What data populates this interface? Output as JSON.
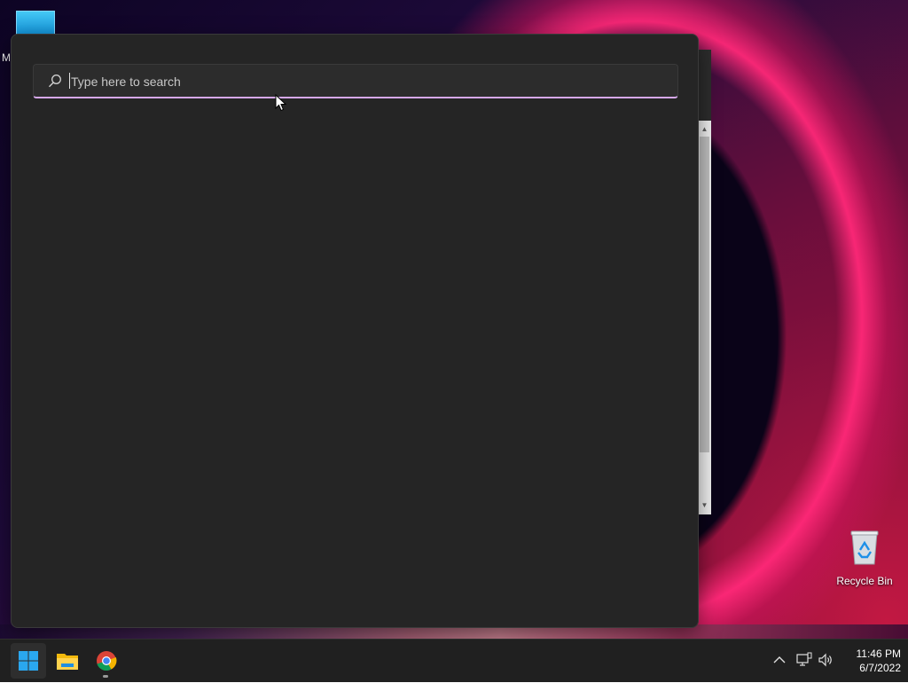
{
  "desktop": {
    "top_icon_label": "M",
    "recycle_bin_label": "Recycle Bin"
  },
  "search": {
    "placeholder": "Type here to search",
    "value": ""
  },
  "taskbar": {
    "apps": [
      "start-button",
      "file-explorer",
      "google-chrome"
    ],
    "tray_icons": [
      "chevron-up-icon",
      "network-icon",
      "volume-icon"
    ],
    "clock_time": "11:46 PM",
    "clock_date": "6/7/2022"
  },
  "colors": {
    "panel_bg": "#252525",
    "search_accent": "#d6a8ec",
    "taskbar_bg": "#202020"
  }
}
